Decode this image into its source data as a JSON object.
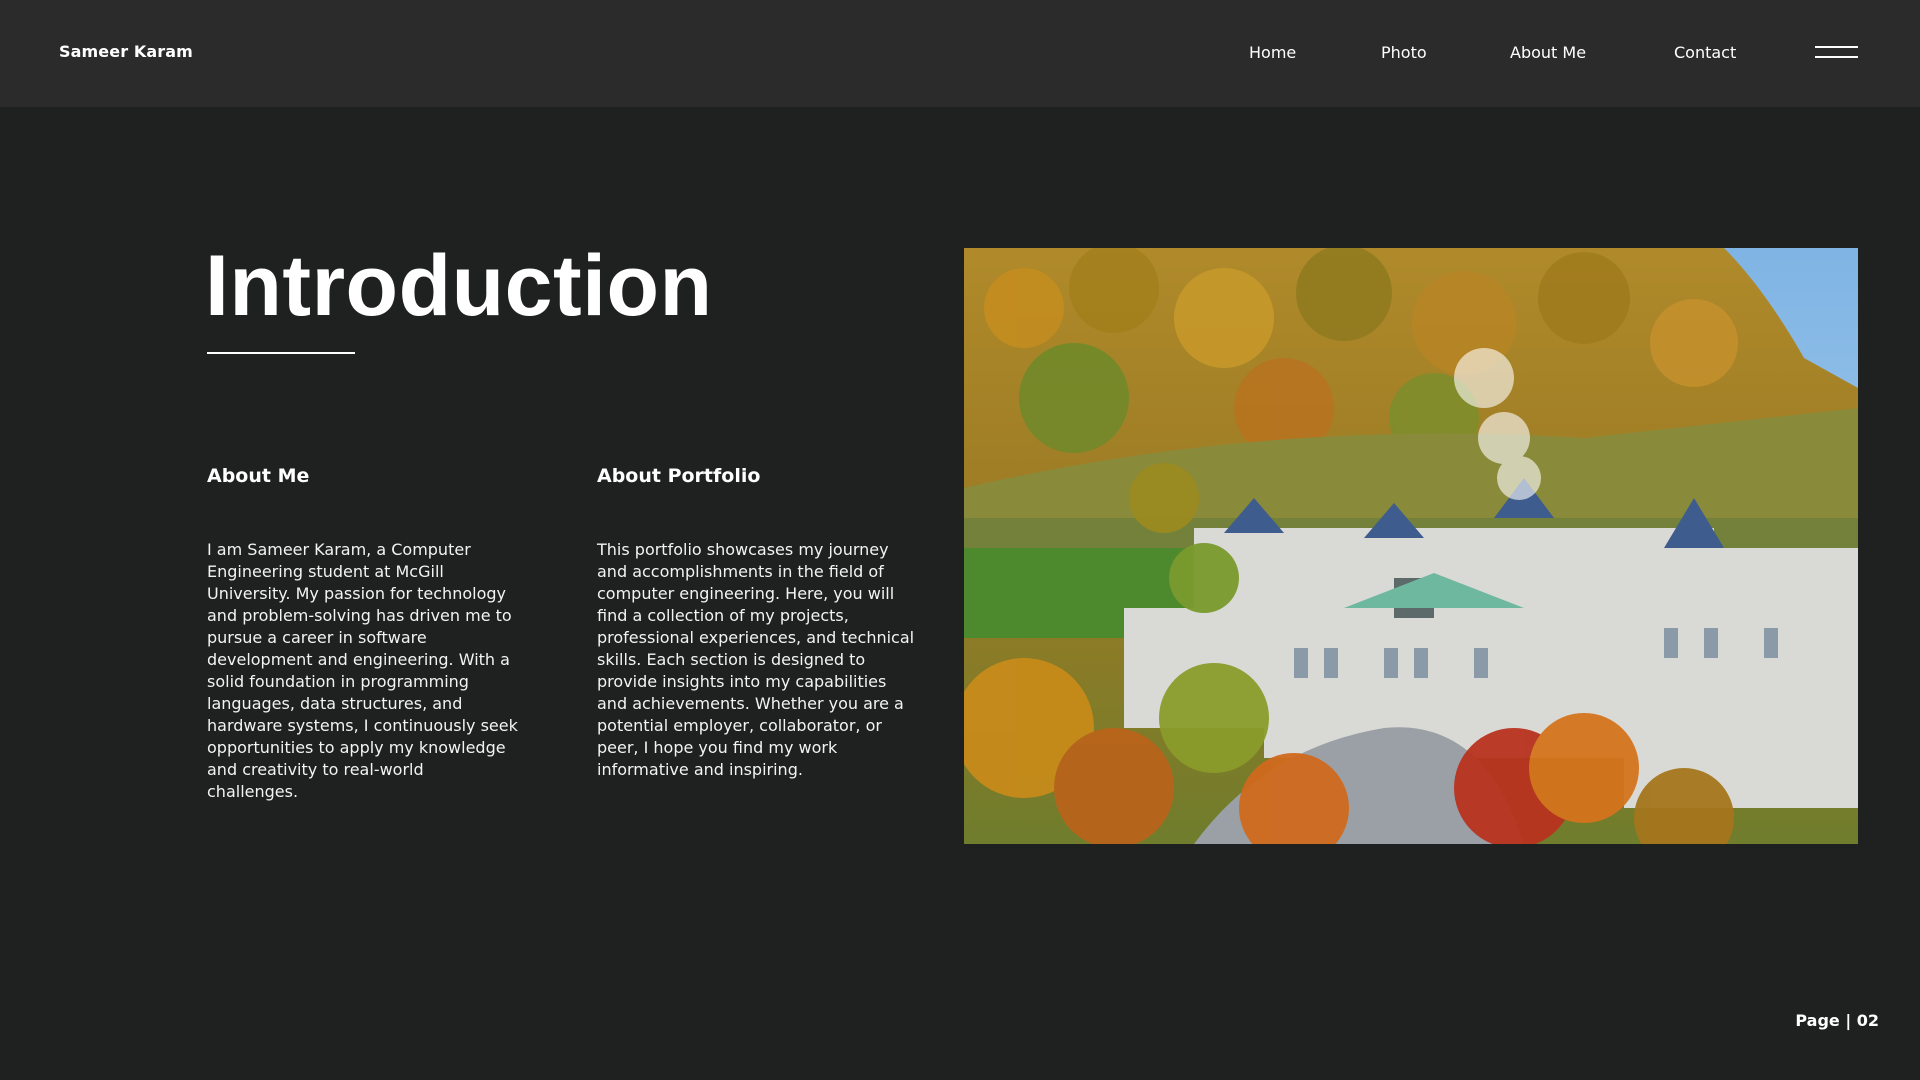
{
  "header": {
    "brand": "Sameer Karam",
    "nav": [
      {
        "label": "Home"
      },
      {
        "label": "Photo"
      },
      {
        "label": "About Me"
      },
      {
        "label": "Contact"
      }
    ],
    "menu_icon": "hamburger-menu-icon"
  },
  "main": {
    "title": "Introduction",
    "about_me": {
      "heading": "About Me",
      "body": "I am Sameer Karam, a Computer Engineering student at McGill University. My passion for technology and problem-solving has driven me to pursue a career in software development and engineering. With a solid foundation in programming languages, data structures, and hardware systems, I continuously seek opportunities to apply my knowledge and creativity to real-world challenges."
    },
    "about_portfolio": {
      "heading": "About Portfolio",
      "body": "This portfolio showcases my journey and accomplishments in the field of computer engineering. Here, you will find a collection of my projects, professional experiences, and technical skills. Each section is designed to provide insights into my capabilities and achievements. Whether you are a potential employer, collaborator, or peer, I hope you find my work informative and inspiring."
    }
  },
  "footer": {
    "page_label": "Page | 02"
  },
  "colors": {
    "background": "#1f2020",
    "header_background": "#2b2b2b",
    "text": "#ffffff"
  }
}
